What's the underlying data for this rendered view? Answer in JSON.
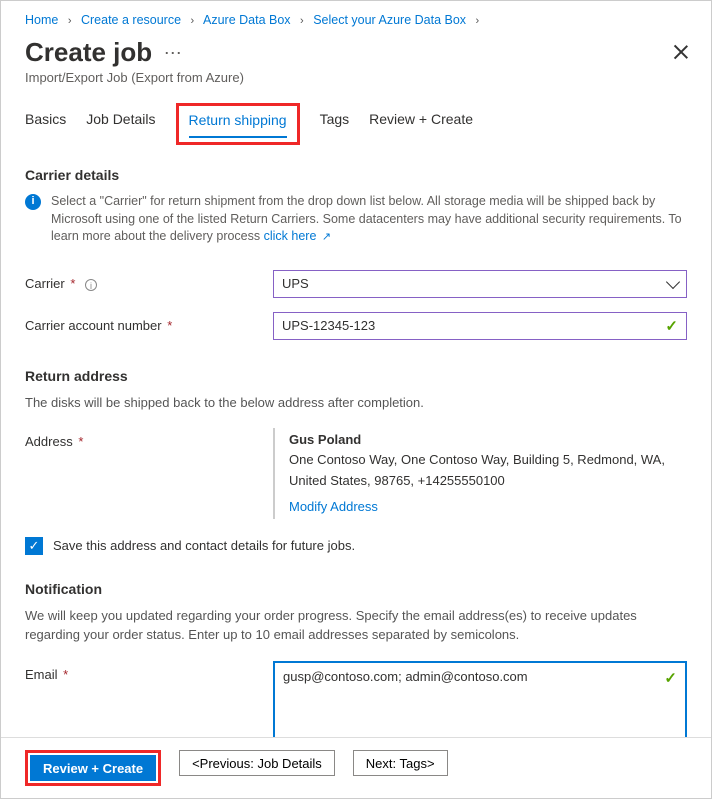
{
  "breadcrumb": {
    "items": [
      "Home",
      "Create a resource",
      "Azure Data Box",
      "Select your Azure Data Box"
    ]
  },
  "header": {
    "title": "Create job",
    "subtitle": "Import/Export Job (Export from Azure)"
  },
  "tabs": {
    "t0": "Basics",
    "t1": "Job Details",
    "t2": "Return shipping",
    "t3": "Tags",
    "t4": "Review + Create",
    "active": "t2"
  },
  "carrier": {
    "section_title": "Carrier details",
    "info_text": "Select a \"Carrier\" for return shipment from the drop down list below. All storage media will be shipped back by Microsoft using one of the listed Return Carriers. Some datacenters may have additional security requirements. To learn more about the delivery process ",
    "info_link": "click here",
    "carrier_label": "Carrier",
    "carrier_value": "UPS",
    "account_label": "Carrier account number",
    "account_value": "UPS-12345-123"
  },
  "return_addr": {
    "section_title": "Return address",
    "section_text": "The disks will be shipped back to the below address after completion.",
    "address_label": "Address",
    "name": "Gus Poland",
    "line": "One Contoso Way, One Contoso Way, Building 5, Redmond, WA, United States, 98765, +14255550100",
    "modify_link": "Modify Address",
    "save_cb_label": "Save this address and contact details for future jobs."
  },
  "notification": {
    "section_title": "Notification",
    "section_text": "We will keep you updated regarding your order progress. Specify the email address(es) to receive updates regarding your order status. Enter up to 10 email addresses separated by semicolons.",
    "email_label": "Email",
    "email_value": "gusp@contoso.com; admin@contoso.com"
  },
  "footer": {
    "review": "Review + Create",
    "prev": "<Previous: Job Details",
    "next": "Next: Tags>"
  }
}
